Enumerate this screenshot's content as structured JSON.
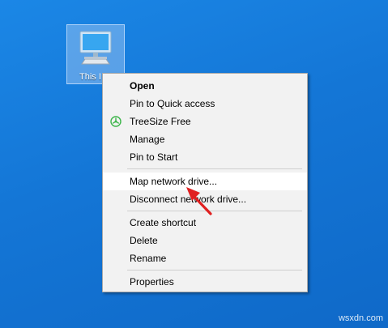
{
  "desktop": {
    "background_color": "#1476d6",
    "this_pc": {
      "label": "This I",
      "icon": "monitor-icon"
    }
  },
  "context_menu": {
    "items": [
      {
        "label": "Open",
        "default": true
      },
      {
        "label": "Pin to Quick access"
      },
      {
        "label": "TreeSize Free",
        "icon": "treesize-icon",
        "icon_color": "#3cb54a"
      },
      {
        "label": "Manage"
      },
      {
        "label": "Pin to Start"
      },
      {
        "label": "Map network drive...",
        "highlighted": true
      },
      {
        "label": "Disconnect network drive..."
      },
      {
        "label": "Create shortcut"
      },
      {
        "label": "Delete"
      },
      {
        "label": "Rename"
      },
      {
        "label": "Properties"
      }
    ],
    "highlight_color": "#ffffff"
  },
  "annotation": {
    "arrow_color": "#e02020",
    "icon": "red-arrow-icon"
  },
  "watermark": {
    "text": "wsxdn.com"
  }
}
